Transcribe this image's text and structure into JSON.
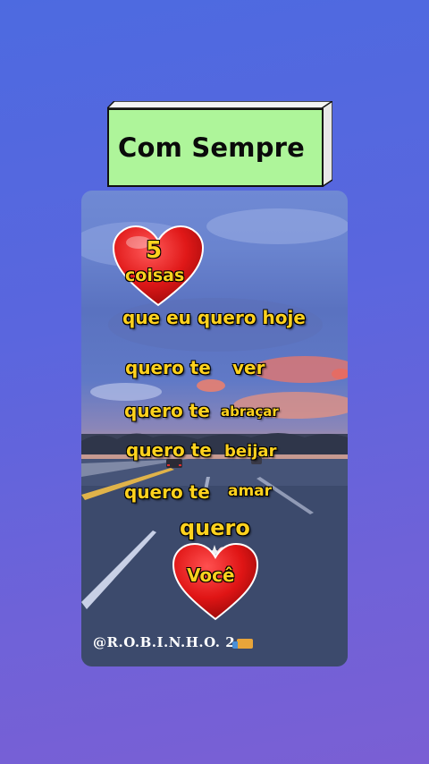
{
  "title": {
    "text": "Com Sempre"
  },
  "card": {
    "heart_top": {
      "number": "5",
      "word": "coisas"
    },
    "subtitle": "que eu quero hoje",
    "lines": [
      {
        "prefix": "quero te",
        "verb": "ver"
      },
      {
        "prefix": "quero te",
        "verb": "abraçar"
      },
      {
        "prefix": "quero te",
        "verb": "beijar"
      },
      {
        "prefix": "quero te",
        "verb": "amar"
      }
    ],
    "quero": "quero",
    "heart_bottom": {
      "word": "Você"
    },
    "watermark": "@R.O.B.I.N.H.O. 2"
  },
  "colors": {
    "title_bg": "#aef59a",
    "text_yellow": "#ffd21e",
    "heart_red": "#e01818"
  },
  "icons": [
    "heart-icon",
    "truck-icon",
    "sparkle-icon"
  ]
}
